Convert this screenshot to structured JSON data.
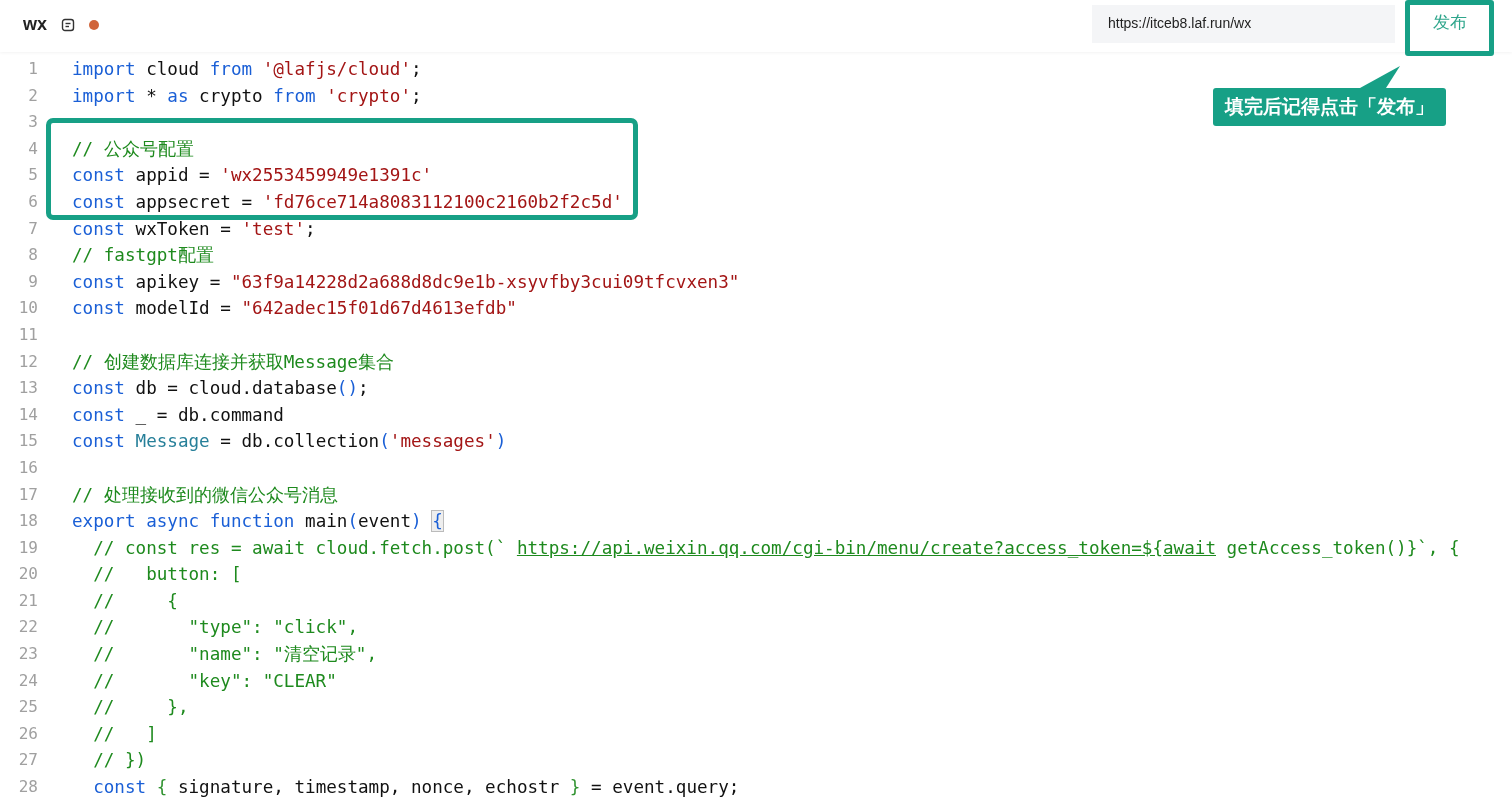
{
  "header": {
    "title": "wx",
    "modified": true,
    "url": "https://itceb8.laf.run/wx",
    "publish_button": "发布"
  },
  "callout": {
    "text": "填完后记得点击「发布」"
  },
  "code": [
    {
      "number": "1",
      "tokens": [
        {
          "kind": "keyword",
          "text": "import"
        },
        {
          "kind": "plain",
          "text": " cloud "
        },
        {
          "kind": "keyword",
          "text": "from"
        },
        {
          "kind": "string",
          "text": " '@lafjs/cloud'"
        },
        {
          "kind": "plain",
          "text": ";"
        }
      ]
    },
    {
      "number": "2",
      "tokens": [
        {
          "kind": "keyword",
          "text": "import"
        },
        {
          "kind": "plain",
          "text": " * "
        },
        {
          "kind": "keyword",
          "text": "as"
        },
        {
          "kind": "plain",
          "text": " crypto "
        },
        {
          "kind": "keyword",
          "text": "from"
        },
        {
          "kind": "string",
          "text": " 'crypto'"
        },
        {
          "kind": "plain",
          "text": ";"
        }
      ]
    },
    {
      "number": "3"
    },
    {
      "number": "4",
      "tokens": [
        {
          "kind": "comment",
          "text": "// 公众号配置"
        }
      ]
    },
    {
      "number": "5",
      "tokens": [
        {
          "kind": "keyword",
          "text": "const"
        },
        {
          "kind": "plain",
          "text": " appid = "
        },
        {
          "kind": "string",
          "text": "'wx2553459949e1391c'"
        }
      ]
    },
    {
      "number": "6",
      "tokens": [
        {
          "kind": "keyword",
          "text": "const"
        },
        {
          "kind": "plain",
          "text": " appsecret = "
        },
        {
          "kind": "string",
          "text": "'fd76ce714a8083112100c2160b2f2c5d'"
        }
      ]
    },
    {
      "number": "7",
      "tokens": [
        {
          "kind": "keyword",
          "text": "const"
        },
        {
          "kind": "plain",
          "text": " wxToken = "
        },
        {
          "kind": "string",
          "text": "'test'"
        },
        {
          "kind": "plain",
          "text": ";"
        }
      ]
    },
    {
      "number": "8",
      "tokens": [
        {
          "kind": "comment",
          "text": "// fastgpt配置"
        }
      ]
    },
    {
      "number": "9",
      "tokens": [
        {
          "kind": "keyword",
          "text": "const"
        },
        {
          "kind": "plain",
          "text": " apikey = "
        },
        {
          "kind": "string",
          "text": "\"63f9a14228d2a688d8dc9e1b-xsyvfby3cui09tfcvxen3\""
        }
      ]
    },
    {
      "number": "10",
      "tokens": [
        {
          "kind": "keyword",
          "text": "const"
        },
        {
          "kind": "plain",
          "text": " modelId = "
        },
        {
          "kind": "string",
          "text": "\"642adec15f01d67d4613efdb\""
        }
      ]
    },
    {
      "number": "11"
    },
    {
      "number": "12",
      "tokens": [
        {
          "kind": "comment",
          "text": "// 创建数据库连接并获取Message集合"
        }
      ]
    },
    {
      "number": "13",
      "tokens": [
        {
          "kind": "keyword",
          "text": "const"
        },
        {
          "kind": "plain",
          "text": " db = cloud.database"
        },
        {
          "kind": "bracket",
          "text": "()"
        },
        {
          "kind": "plain",
          "text": ";"
        }
      ]
    },
    {
      "number": "14",
      "tokens": [
        {
          "kind": "keyword",
          "text": "const"
        },
        {
          "kind": "plain",
          "text": " _ = db.command"
        }
      ]
    },
    {
      "number": "15",
      "tokens": [
        {
          "kind": "keyword",
          "text": "const"
        },
        {
          "kind": "type",
          "text": " Message"
        },
        {
          "kind": "plain",
          "text": " = db.collection"
        },
        {
          "kind": "bracket",
          "text": "("
        },
        {
          "kind": "string",
          "text": "'messages'"
        },
        {
          "kind": "bracket",
          "text": ")"
        }
      ]
    },
    {
      "number": "16"
    },
    {
      "number": "17",
      "tokens": [
        {
          "kind": "comment",
          "text": "// 处理接收到的微信公众号消息"
        }
      ]
    },
    {
      "number": "18",
      "tokens": [
        {
          "kind": "keyword",
          "text": "export"
        },
        {
          "kind": "keyword",
          "text": " async"
        },
        {
          "kind": "keyword",
          "text": " function"
        },
        {
          "kind": "plain",
          "text": " main"
        },
        {
          "kind": "bracket",
          "text": "("
        },
        {
          "kind": "plain",
          "text": "event"
        },
        {
          "kind": "bracket",
          "text": ") "
        },
        {
          "kind": "bracket_match",
          "text": "{"
        }
      ]
    },
    {
      "number": "19",
      "tokens": [
        {
          "kind": "comment",
          "text": "  // const res = await cloud.fetch.post(` "
        },
        {
          "kind": "link",
          "text": "https://api.weixin.qq.com/cgi-bin/menu/create?access_token=${await"
        },
        {
          "kind": "comment",
          "text": " getAccess_token()}`, {"
        }
      ]
    },
    {
      "number": "20",
      "tokens": [
        {
          "kind": "comment",
          "text": "  //   button: ["
        }
      ]
    },
    {
      "number": "21",
      "tokens": [
        {
          "kind": "comment",
          "text": "  //     {"
        }
      ]
    },
    {
      "number": "22",
      "tokens": [
        {
          "kind": "comment",
          "text": "  //       \"type\": \"click\","
        }
      ]
    },
    {
      "number": "23",
      "tokens": [
        {
          "kind": "comment",
          "text": "  //       \"name\": \"清空记录\","
        }
      ]
    },
    {
      "number": "24",
      "tokens": [
        {
          "kind": "comment",
          "text": "  //       \"key\": \"CLEAR\""
        }
      ]
    },
    {
      "number": "25",
      "tokens": [
        {
          "kind": "comment",
          "text": "  //     },"
        }
      ]
    },
    {
      "number": "26",
      "tokens": [
        {
          "kind": "comment",
          "text": "  //   ]"
        }
      ]
    },
    {
      "number": "27",
      "tokens": [
        {
          "kind": "comment",
          "text": "  // })"
        }
      ]
    },
    {
      "number": "28",
      "tokens": [
        {
          "kind": "keyword",
          "text": "  const"
        },
        {
          "kind": "bracket2",
          "text": " {"
        },
        {
          "kind": "plain",
          "text": " signature, timestamp, nonce, echostr "
        },
        {
          "kind": "bracket2",
          "text": "}"
        },
        {
          "kind": "plain",
          "text": " = event.query;"
        }
      ]
    }
  ]
}
